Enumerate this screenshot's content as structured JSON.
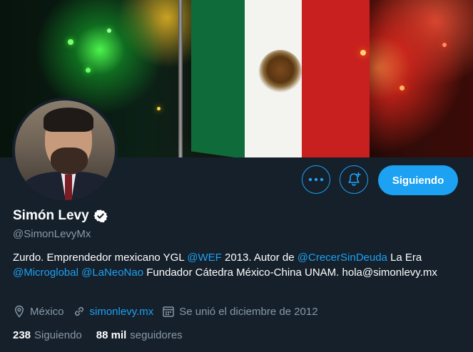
{
  "colors": {
    "background": "#15202b",
    "accent": "#1da1f2",
    "secondary_text": "#8899a6",
    "text": "#ffffff"
  },
  "actions": {
    "more_icon": "more-icon",
    "notify_icon": "notification-bell-plus-icon",
    "follow_label": "Siguiendo"
  },
  "profile": {
    "name": "Simón Levy",
    "verified_icon": "verified-badge-icon",
    "handle": "@SimonLevyMx",
    "bio": {
      "t1": "Zurdo. Emprendedor mexicano YGL ",
      "m1": "@WEF",
      "t2": " 2013. Autor de ",
      "m2": "@CrecerSinDeuda",
      "t3": " La Era ",
      "m3": "@Microglobal",
      "t4": " ",
      "m4": "@LaNeoNao",
      "t5": " Fundador Cátedra México-China UNAM. hola@simonlevy.mx"
    },
    "location": "México",
    "website": "simonlevy.mx",
    "joined": "Se unió el diciembre de 2012",
    "following_count": "238",
    "following_label": "Siguiendo",
    "followers_count": "88 mil",
    "followers_label": "seguidores"
  }
}
